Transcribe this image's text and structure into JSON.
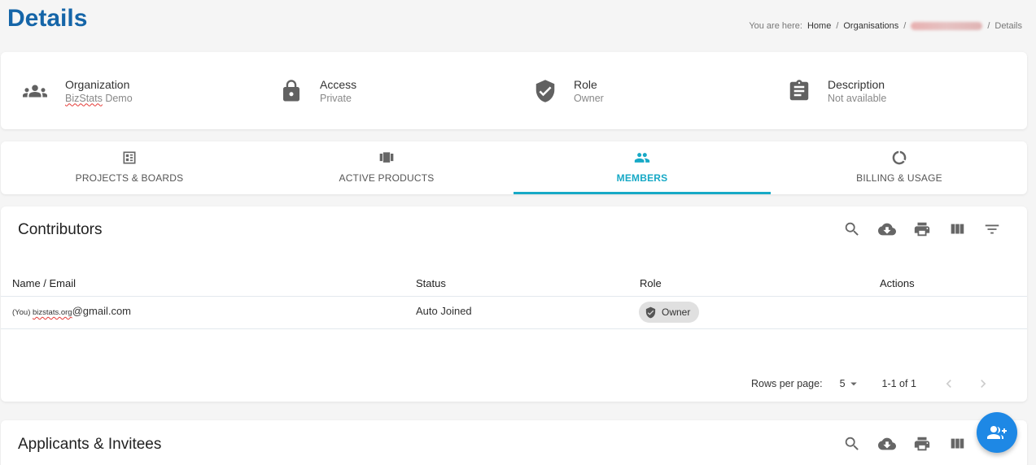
{
  "header": {
    "title": "Details",
    "breadcrumb": {
      "prefix": "You are here:",
      "items": [
        "Home",
        "Organisations",
        "Details"
      ],
      "separator": "/"
    }
  },
  "info": {
    "organization": {
      "label": "Organization",
      "value": "BizStats Demo",
      "value_word1": "BizStats",
      "value_word2": " Demo",
      "icon": "group-icon"
    },
    "access": {
      "label": "Access",
      "value": "Private",
      "icon": "lock-icon"
    },
    "role": {
      "label": "Role",
      "value": "Owner",
      "icon": "shield-check-icon"
    },
    "description": {
      "label": "Description",
      "value": "Not available",
      "icon": "clipboard-icon"
    }
  },
  "tabs": [
    {
      "label": "PROJECTS & BOARDS",
      "icon": "dashboard-icon",
      "active": false
    },
    {
      "label": "ACTIVE PRODUCTS",
      "icon": "view-carousel-icon",
      "active": false
    },
    {
      "label": "MEMBERS",
      "icon": "people-icon",
      "active": true
    },
    {
      "label": "BILLING & USAGE",
      "icon": "donut-icon",
      "active": false
    }
  ],
  "contributors": {
    "title": "Contributors",
    "columns": [
      "Name / Email",
      "Status",
      "Role",
      "Actions"
    ],
    "rows": [
      {
        "name_prefix": "(You) ",
        "name_misspelled": "bizstats.org",
        "name_rest": "@gmail.com",
        "status": "Auto Joined",
        "role": "Owner"
      }
    ],
    "pagination": {
      "rows_per_page_label": "Rows per page:",
      "rows_per_page": "5",
      "range": "1-1 of 1"
    }
  },
  "applicants": {
    "title": "Applicants & Invitees"
  },
  "colors": {
    "accent": "#17a9c6",
    "title": "#1565a8",
    "fab": "#1e88e5"
  }
}
